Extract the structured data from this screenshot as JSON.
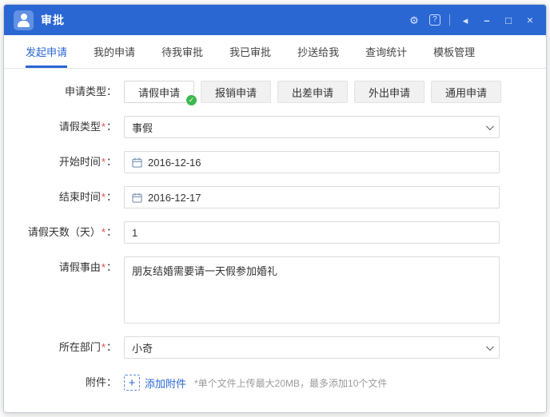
{
  "colors": {
    "accent": "#2a67d3",
    "success": "#3cb84e",
    "required": "#e84a3f"
  },
  "titlebar": {
    "title": "审批",
    "icons": {
      "gear": "⚙",
      "help": "?",
      "pin": "◂",
      "minimize": "–",
      "maximize": "□",
      "close": "×"
    }
  },
  "tabs": [
    {
      "label": "发起申请",
      "active": true
    },
    {
      "label": "我的申请",
      "active": false
    },
    {
      "label": "待我审批",
      "active": false
    },
    {
      "label": "我已审批",
      "active": false
    },
    {
      "label": "抄送给我",
      "active": false
    },
    {
      "label": "查询统计",
      "active": false
    },
    {
      "label": "模板管理",
      "active": false
    }
  ],
  "form": {
    "marks": {
      "required": "*",
      "colon": "："
    },
    "apply_type": {
      "label": "申请类型",
      "options": [
        {
          "label": "请假申请",
          "selected": true
        },
        {
          "label": "报销申请",
          "selected": false
        },
        {
          "label": "出差申请",
          "selected": false
        },
        {
          "label": "外出申请",
          "selected": false
        },
        {
          "label": "通用申请",
          "selected": false
        }
      ],
      "check_glyph": "✓"
    },
    "fields": [
      {
        "label": "请假类型",
        "value": "事假"
      },
      {
        "label": "开始时间",
        "value": "2016-12-16"
      },
      {
        "label": "结束时间",
        "value": "2016-12-17"
      },
      {
        "label": "请假天数（天）",
        "value": "1"
      },
      {
        "label": "请假事由",
        "value": "朋友结婚需要请一天假参加婚礼"
      },
      {
        "label": "所在部门",
        "value": "小奇"
      }
    ],
    "attachment": {
      "label": "附件",
      "plus_glyph": "+",
      "add_label": "添加附件",
      "hint": "*单个文件上传最大20MB，最多添加10个文件"
    }
  }
}
